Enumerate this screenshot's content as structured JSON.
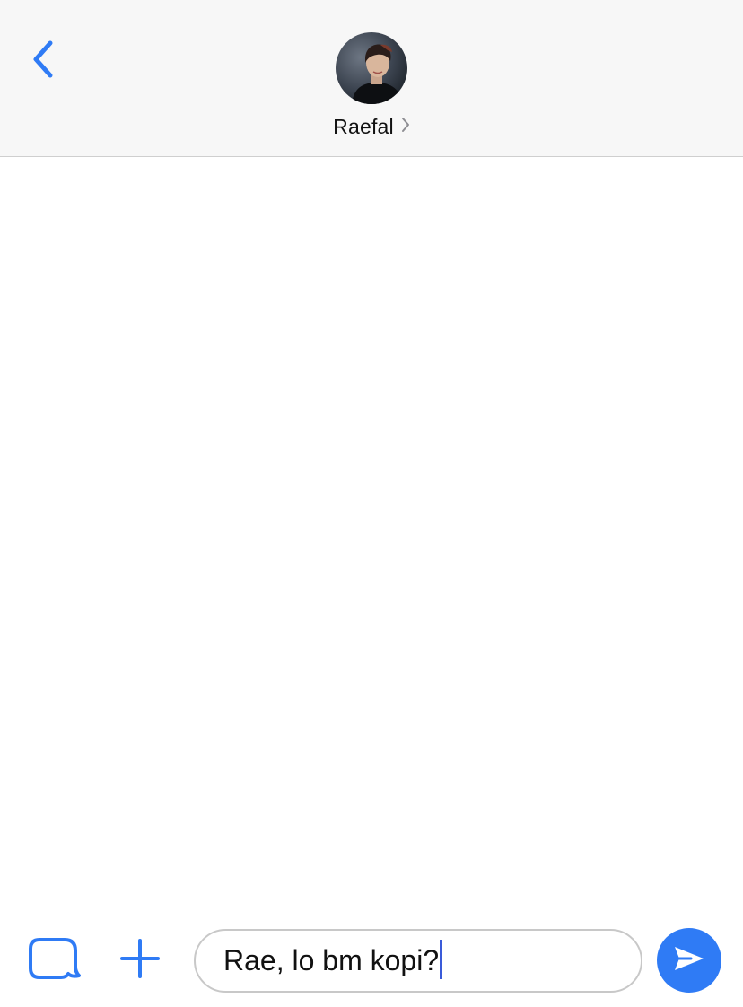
{
  "header": {
    "back_icon": "chevron-left-icon",
    "contact": {
      "name": "Raefal",
      "avatar_icon": "profile-photo",
      "disclosure_icon": "chevron-right-icon"
    }
  },
  "conversation": {
    "messages": []
  },
  "composer": {
    "sticker_icon": "speech-bubble-icon",
    "add_icon": "plus-icon",
    "message_value": "Rae, lo bm kopi?",
    "send_icon": "paper-plane-send-icon"
  },
  "colors": {
    "accent": "#2f7bf5",
    "header_bg": "#f7f7f7",
    "caret": "#3a5bd9"
  }
}
